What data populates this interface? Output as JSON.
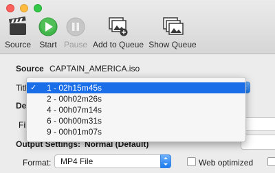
{
  "toolbar": {
    "source_label": "Source",
    "start_label": "Start",
    "pause_label": "Pause",
    "add_to_queue_label": "Add to Queue",
    "show_queue_label": "Show Queue"
  },
  "source": {
    "label": "Source",
    "value": "CAPTAIN_AMERICA.iso"
  },
  "title": {
    "label": "Title",
    "options": [
      {
        "label": "1 - 02h15m45s",
        "selected": true
      },
      {
        "label": "2 - 00h02m26s",
        "selected": false
      },
      {
        "label": "4 - 00h07m14s",
        "selected": false
      },
      {
        "label": "6 - 00h00m31s",
        "selected": false
      },
      {
        "label": "9 - 00h01m07s",
        "selected": false
      }
    ],
    "check_mark": "✓"
  },
  "destination": {
    "label_partial": "Des",
    "file_label_partial": "File"
  },
  "output": {
    "label": "Output Settings:",
    "preset": "Normal (Default)",
    "format_label": "Format:",
    "format_value": "MP4 File",
    "web_optimized_label": "Web optimized",
    "web_optimized_checked": false
  },
  "colors": {
    "menu_highlight": "#1a6fe8",
    "start_green": "#3fb54a",
    "popup_blue": "#1a7bf0"
  }
}
